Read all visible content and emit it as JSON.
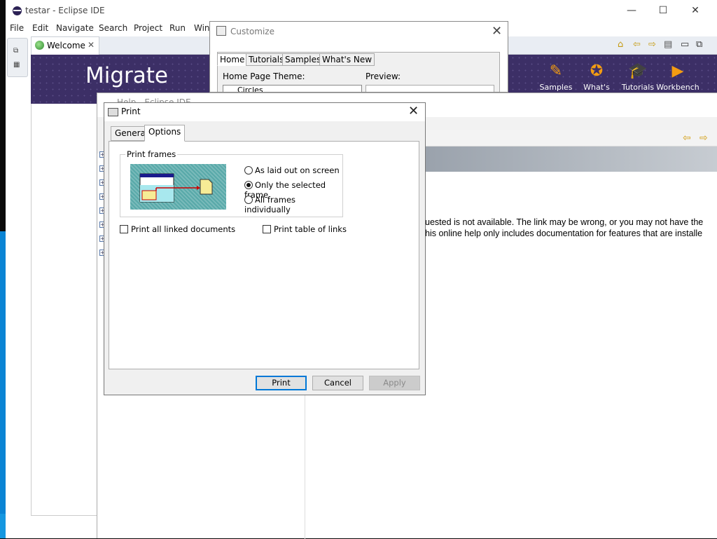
{
  "main_window": {
    "title": "testar - Eclipse IDE",
    "menu": [
      "File",
      "Edit",
      "Navigate",
      "Search",
      "Project",
      "Run",
      "Win"
    ],
    "welcome_tab": "Welcome",
    "banner_heading": "Migrate",
    "banner_items": [
      "Samples",
      "What's New",
      "Tutorials",
      "Workbench"
    ]
  },
  "customize_dialog": {
    "title": "Customize",
    "tabs": [
      "Home",
      "Tutorials",
      "Samples",
      "What's New"
    ],
    "theme_label": "Home Page Theme:",
    "preview_label": "Preview:",
    "theme_value": "Circles"
  },
  "help_window": {
    "title": "Help - Eclipse IDE",
    "message_line1": "uested is not available. The link may be wrong, or you may not have the",
    "message_line2": "his online help only includes documentation for features that are installe"
  },
  "print_dialog": {
    "title": "Print",
    "tabs": [
      "General",
      "Options"
    ],
    "active_tab": "Options",
    "frames_group_label": "Print frames",
    "frame_options": [
      "As laid out on screen",
      "Only the selected frame",
      "All frames individually"
    ],
    "selected_frame_option": "Only the selected frame",
    "print_linked_docs_label": "Print all linked documents",
    "print_linked_docs_checked": false,
    "print_links_table_label": "Print table of links",
    "print_links_table_checked": false,
    "buttons": {
      "print": "Print",
      "cancel": "Cancel",
      "apply": "Apply"
    },
    "apply_enabled": false
  },
  "colors": {
    "banner_bg": "#3c2f66",
    "accent_orange": "#f39c12",
    "default_button_border": "#0078d7"
  }
}
